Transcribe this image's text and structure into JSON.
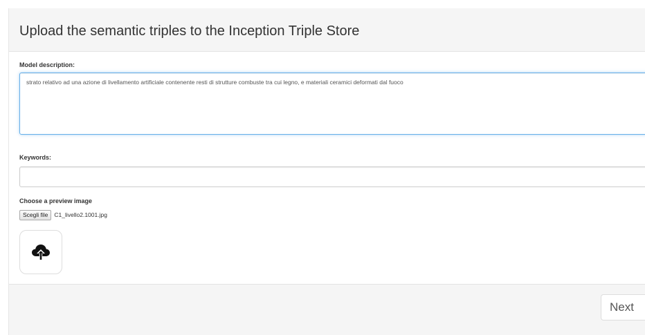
{
  "header": {
    "title": "Upload the semantic triples to the Inception Triple Store"
  },
  "form": {
    "model_description": {
      "label": "Model description:",
      "value": "strato relativo ad una azione di livellamento artificiale contenente resti di strutture combuste tra cui legno, e materiali ceramici deformati dal fuoco"
    },
    "keywords": {
      "label": "Keywords:",
      "value": ""
    },
    "preview_image": {
      "label": "Choose a preview image",
      "button_label": "Scegli file",
      "file_name": "C1_livello2.1001.jpg",
      "icon": "cloud-upload-icon"
    }
  },
  "footer": {
    "next_label": "Next"
  }
}
